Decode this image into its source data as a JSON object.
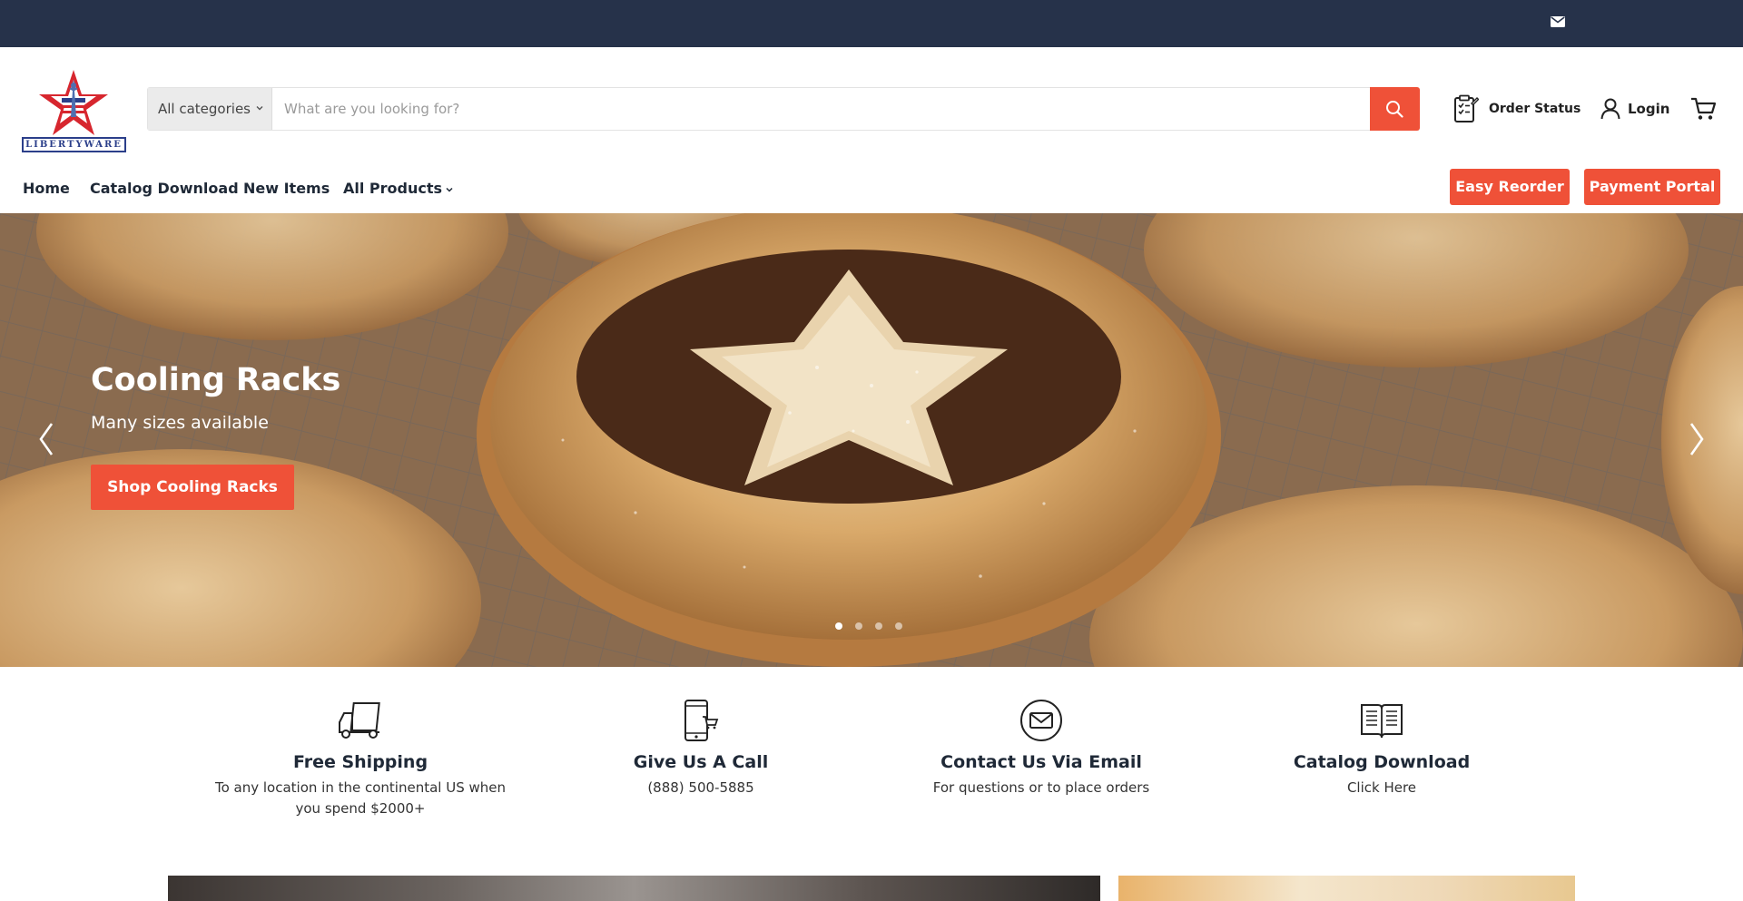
{
  "brand": {
    "logo_text": "LIBERTYWARE"
  },
  "search": {
    "category": "All categories",
    "placeholder": "What are you looking for?"
  },
  "header_links": {
    "order_status": "Order Status",
    "login": "Login"
  },
  "nav": {
    "items": [
      {
        "label": "Home"
      },
      {
        "label": "Catalog Download"
      },
      {
        "label": "New Items"
      },
      {
        "label": "All Products"
      }
    ],
    "buttons": {
      "easy_reorder": "Easy Reorder",
      "payment_portal": "Payment Portal"
    }
  },
  "hero": {
    "title": "Cooling Racks",
    "subtitle": "Many sizes available",
    "cta": "Shop Cooling Racks",
    "slide_count": 4,
    "active_slide": 1
  },
  "features": [
    {
      "icon": "truck-icon",
      "title": "Free Shipping",
      "desc": "To any location in the continental US when you spend $2000+"
    },
    {
      "icon": "phone-cart-icon",
      "title": "Give Us A Call",
      "desc": "(888) 500-5885"
    },
    {
      "icon": "email-circle-icon",
      "title": "Contact Us Via Email",
      "desc": "For questions or to place orders"
    },
    {
      "icon": "open-book-icon",
      "title": "Catalog Download",
      "desc": "Click Here"
    }
  ],
  "colors": {
    "topbar": "#26324a",
    "accent": "#ef5138",
    "text": "#1f2937"
  }
}
